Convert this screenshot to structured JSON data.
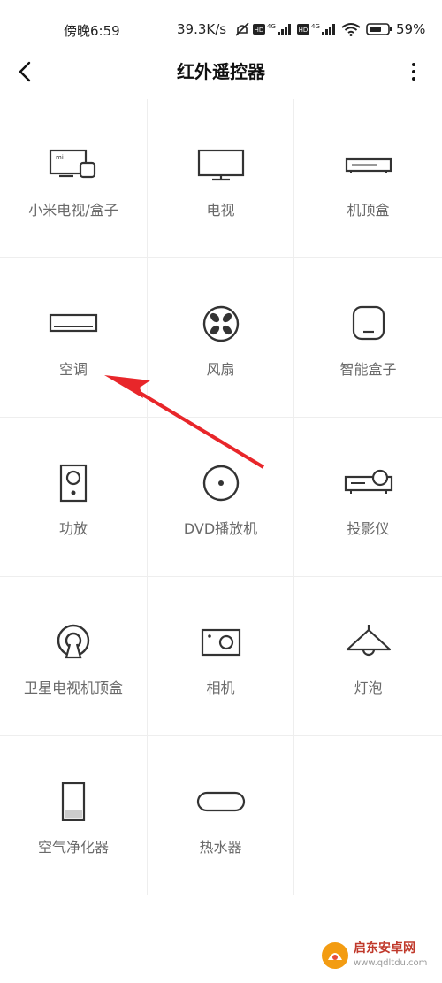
{
  "status_bar": {
    "time": "傍晚6:59",
    "net_speed": "39.3K/s",
    "battery": "59%",
    "icons": [
      "mute-icon",
      "hd-icon",
      "signal-4g-icon",
      "hd-icon",
      "signal-4g-icon",
      "wifi-icon",
      "battery-icon"
    ]
  },
  "header": {
    "title": "红外遥控器",
    "back_icon": "chevron-left-icon",
    "more_icon": "more-vertical-icon"
  },
  "devices": [
    {
      "label": "小米电视/盒子",
      "icon": "mi-tv-box-icon"
    },
    {
      "label": "电视",
      "icon": "tv-icon"
    },
    {
      "label": "机顶盒",
      "icon": "set-top-box-icon"
    },
    {
      "label": "空调",
      "icon": "air-conditioner-icon"
    },
    {
      "label": "风扇",
      "icon": "fan-icon"
    },
    {
      "label": "智能盒子",
      "icon": "smart-box-icon"
    },
    {
      "label": "功放",
      "icon": "speaker-icon"
    },
    {
      "label": "DVD播放机",
      "icon": "disc-icon"
    },
    {
      "label": "投影仪",
      "icon": "projector-icon"
    },
    {
      "label": "卫星电视机顶盒",
      "icon": "satellite-icon"
    },
    {
      "label": "相机",
      "icon": "camera-icon"
    },
    {
      "label": "灯泡",
      "icon": "lamp-icon"
    },
    {
      "label": "空气净化器",
      "icon": "air-purifier-icon"
    },
    {
      "label": "热水器",
      "icon": "water-heater-icon"
    }
  ],
  "watermark": {
    "text": "启东安卓网",
    "url": "www.qdltdu.com"
  },
  "colors": {
    "annotation_arrow": "#e8262a",
    "label": "#6a6a6a",
    "icon_stroke": "#333333",
    "divider": "#eeeeee"
  }
}
